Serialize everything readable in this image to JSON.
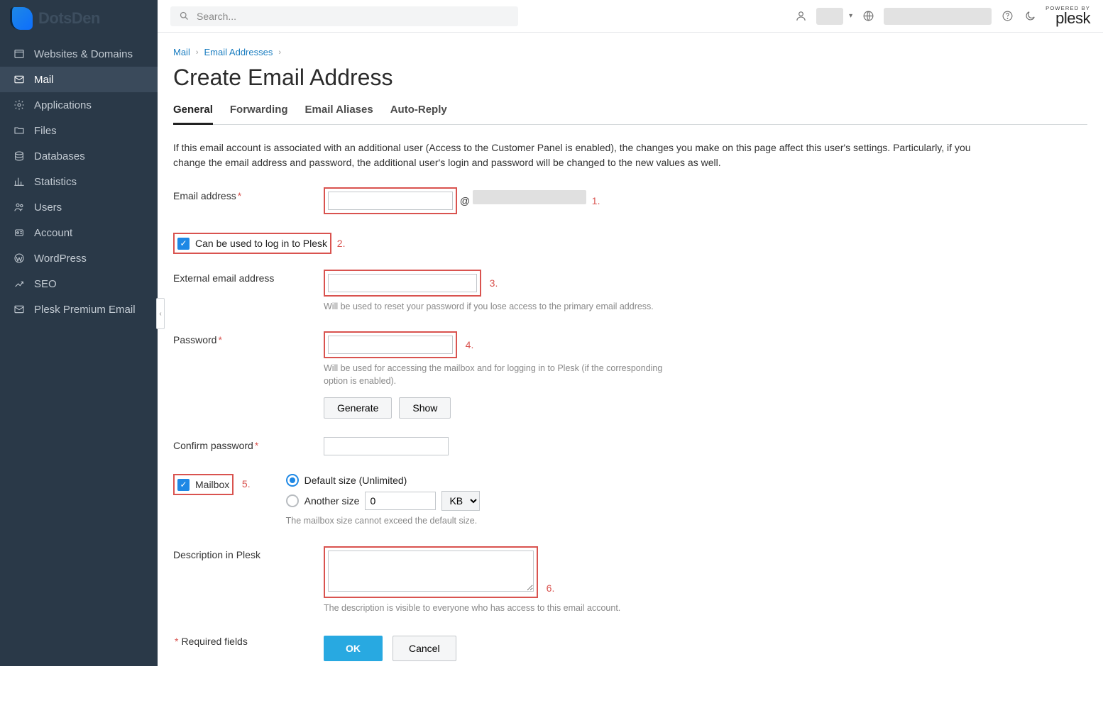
{
  "brand": "DotsDen",
  "sidebar": {
    "items": [
      {
        "label": "Websites & Domains"
      },
      {
        "label": "Mail"
      },
      {
        "label": "Applications"
      },
      {
        "label": "Files"
      },
      {
        "label": "Databases"
      },
      {
        "label": "Statistics"
      },
      {
        "label": "Users"
      },
      {
        "label": "Account"
      },
      {
        "label": "WordPress"
      },
      {
        "label": "SEO"
      },
      {
        "label": "Plesk Premium Email"
      }
    ]
  },
  "topbar": {
    "search_placeholder": "Search...",
    "powered_label": "POWERED BY",
    "plesk_label": "plesk"
  },
  "breadcrumbs": {
    "mail": "Mail",
    "email_addresses": "Email Addresses"
  },
  "page_title": "Create Email Address",
  "tabs": {
    "general": "General",
    "forwarding": "Forwarding",
    "aliases": "Email Aliases",
    "autoreply": "Auto-Reply"
  },
  "intro": "If this email account is associated with an additional user (Access to the Customer Panel is enabled), the changes you make on this page affect this user's settings. Particularly, if you change the email address and password, the additional user's login and password will be changed to the new values as well.",
  "form": {
    "email_label": "Email address",
    "at": "@",
    "can_login_label": "Can be used to log in to Plesk",
    "external_label": "External email address",
    "external_help": "Will be used to reset your password if you lose access to the primary email address.",
    "password_label": "Password",
    "password_help": "Will be used for accessing the mailbox and for logging in to Plesk (if the corresponding option is enabled).",
    "generate_btn": "Generate",
    "show_btn": "Show",
    "confirm_label": "Confirm password",
    "mailbox_label": "Mailbox",
    "default_size_label": "Default size (Unlimited)",
    "another_size_label": "Another size",
    "another_size_value": "0",
    "another_size_unit": "KB",
    "mailbox_help": "The mailbox size cannot exceed the default size.",
    "description_label": "Description in Plesk",
    "description_help": "The description is visible to everyone who has access to this email account.",
    "required_note": "Required fields",
    "ok_btn": "OK",
    "cancel_btn": "Cancel"
  },
  "annotations": {
    "a1": "1.",
    "a2": "2.",
    "a3": "3.",
    "a4": "4.",
    "a5": "5.",
    "a6": "6."
  }
}
